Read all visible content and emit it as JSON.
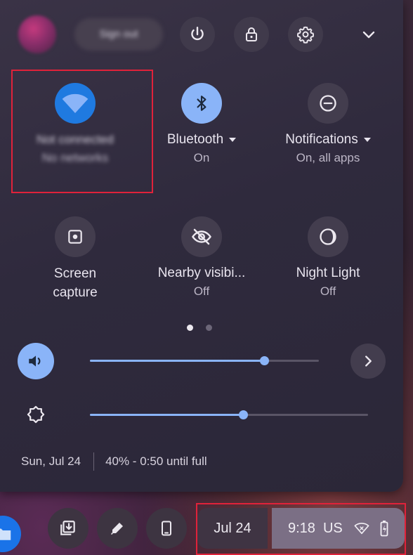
{
  "header": {
    "sign_out_label": "Sign out"
  },
  "tiles_row1": [
    {
      "label": "Not connected",
      "sub": "No networks",
      "icon": "wifi-icon"
    },
    {
      "label": "Bluetooth",
      "sub": "On",
      "icon": "bluetooth-icon"
    },
    {
      "label": "Notifications",
      "sub": "On, all apps",
      "icon": "do-not-disturb-icon"
    }
  ],
  "tiles_row2": [
    {
      "label": "Screen\ncapture",
      "icon": "screen-capture-icon"
    },
    {
      "label": "Nearby visibi...",
      "sub": "Off",
      "icon": "eye-off-icon"
    },
    {
      "label": "Night Light",
      "sub": "Off",
      "icon": "night-light-icon"
    }
  ],
  "pager": {
    "pages": 2,
    "current": 1
  },
  "volume": {
    "level_percent": 76
  },
  "brightness": {
    "level_percent": 55
  },
  "footer": {
    "date": "Sun, Jul 24",
    "battery": "40% - 0:50 until full"
  },
  "shelf": {
    "date_label": "Jul 24",
    "time": "9:18",
    "ime": "US"
  },
  "colors": {
    "accent": "#8ab4f8",
    "highlight_box": "#e0223a",
    "wifi_blue": "#1f7ae0"
  }
}
